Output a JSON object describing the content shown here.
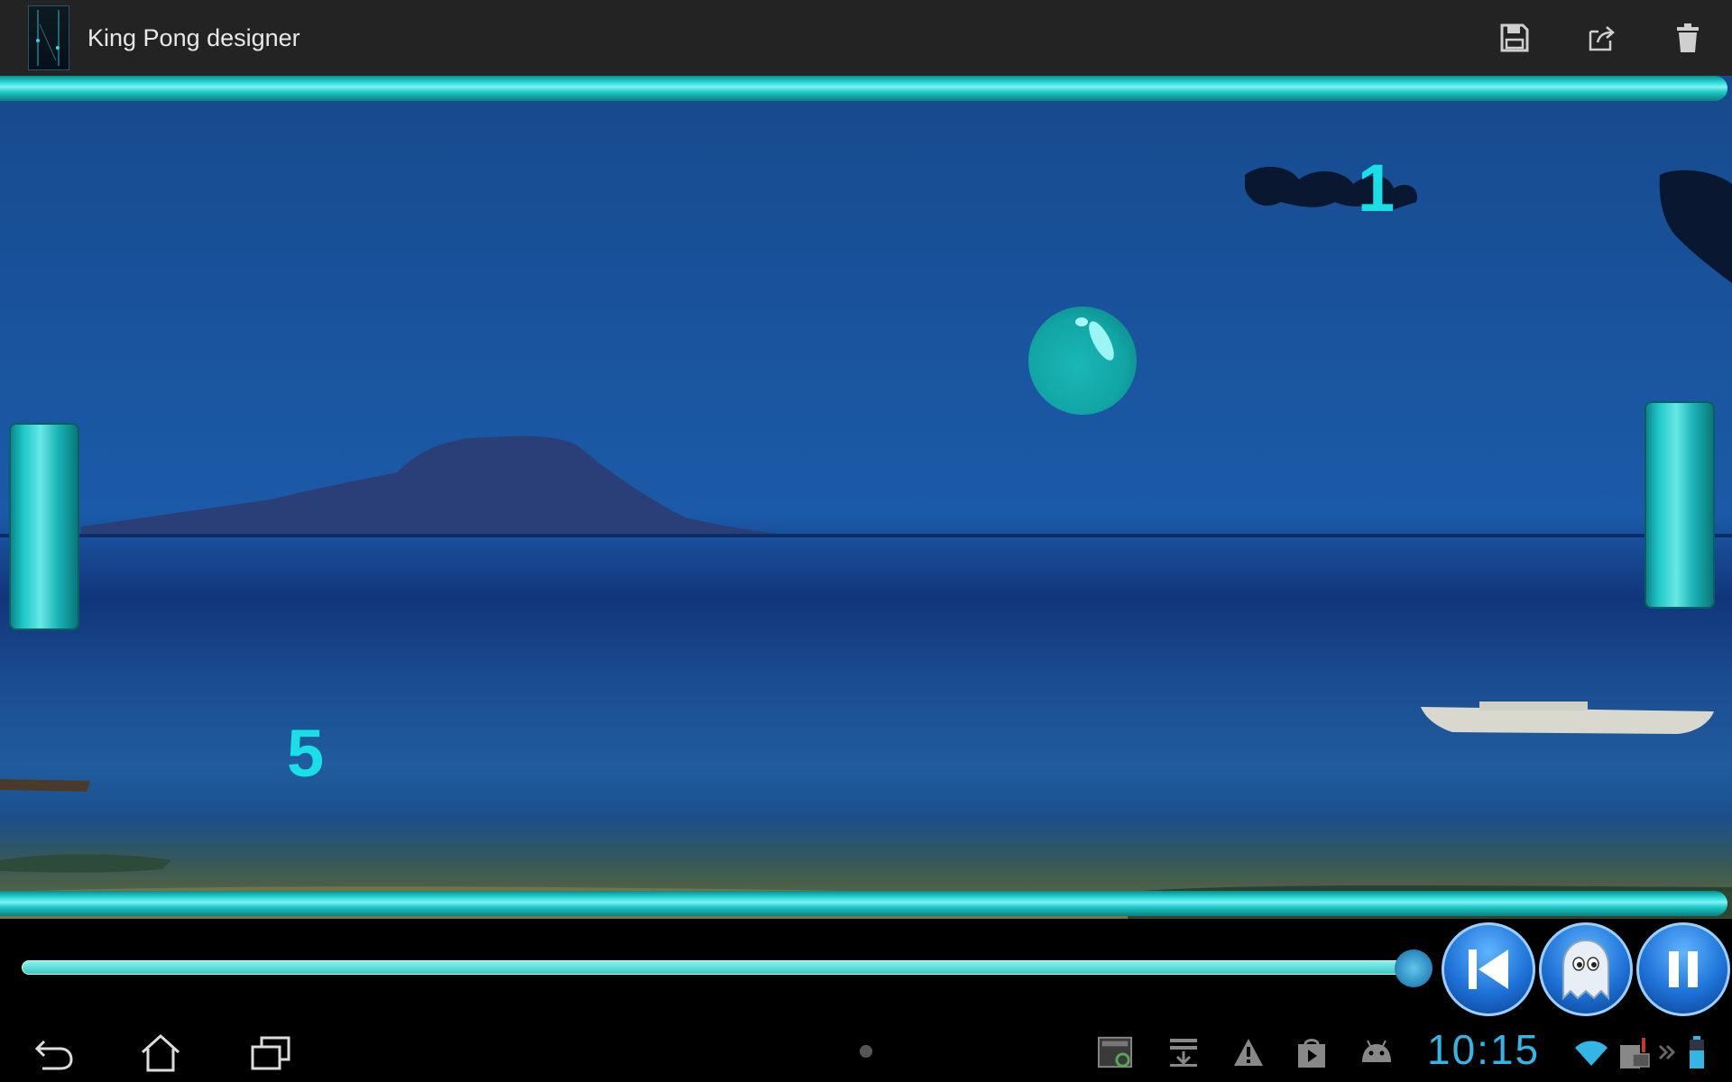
{
  "app": {
    "title": "King Pong designer",
    "icon": "king-pong-app-icon"
  },
  "actions": [
    {
      "name": "save",
      "icon": "floppy-disk-icon"
    },
    {
      "name": "share",
      "icon": "share-export-icon"
    },
    {
      "name": "delete",
      "icon": "trash-icon"
    }
  ],
  "game": {
    "score_right": "1",
    "score_left": "5",
    "background": "tropical beach with island at dusk",
    "accent_color": "#1ec7c8"
  },
  "playback": {
    "progress": 0.98,
    "buttons": [
      {
        "name": "rewind",
        "icon": "skip-to-start-icon"
      },
      {
        "name": "ghost",
        "icon": "ghost-icon"
      },
      {
        "name": "pause",
        "icon": "pause-icon"
      }
    ]
  },
  "system": {
    "clock": "10:15",
    "nav": [
      "back-icon",
      "home-icon",
      "recent-apps-icon"
    ],
    "tray": [
      "screenshot-sync-icon",
      "download-icon",
      "warning-icon",
      "play-store-icon",
      "android-icon",
      "wifi-icon",
      "sim-alert-icon",
      "overflow-icon",
      "battery-icon"
    ],
    "clock_color": "#33b5e5"
  }
}
